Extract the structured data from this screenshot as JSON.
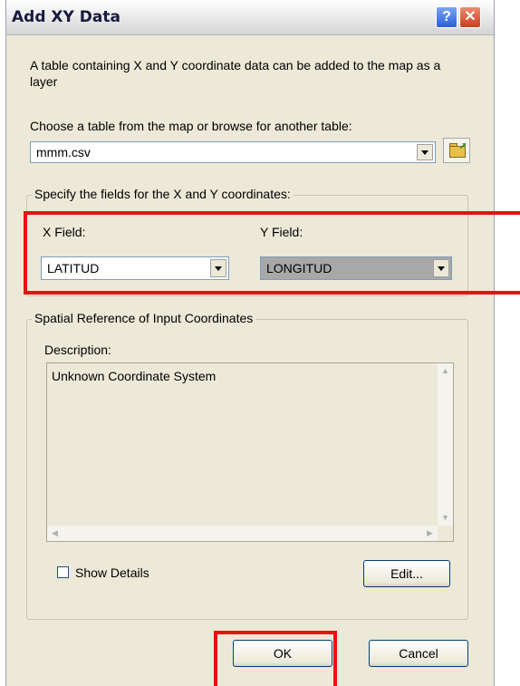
{
  "window": {
    "title": "Add XY Data",
    "help_glyph": "?",
    "close_glyph": "✕"
  },
  "intro_text": "A table containing X and Y coordinate data can be added to the map as a layer",
  "table_prompt": "Choose a table from the map or browse for another table:",
  "table_combo": {
    "value": "mmm.csv"
  },
  "fields_group": {
    "legend": "Specify the fields for the X and Y coordinates:",
    "x_label": "X Field:",
    "x_value": "LATITUD",
    "y_label": "Y Field:",
    "y_value": "LONGITUD"
  },
  "spatial_group": {
    "legend": "Spatial Reference of Input Coordinates",
    "description_label": "Description:",
    "description_text": "Unknown Coordinate System"
  },
  "show_details_label": "Show Details",
  "edit_button": "Edit...",
  "ok_button": "OK",
  "cancel_button": "Cancel",
  "highlight_color": "#e81010"
}
